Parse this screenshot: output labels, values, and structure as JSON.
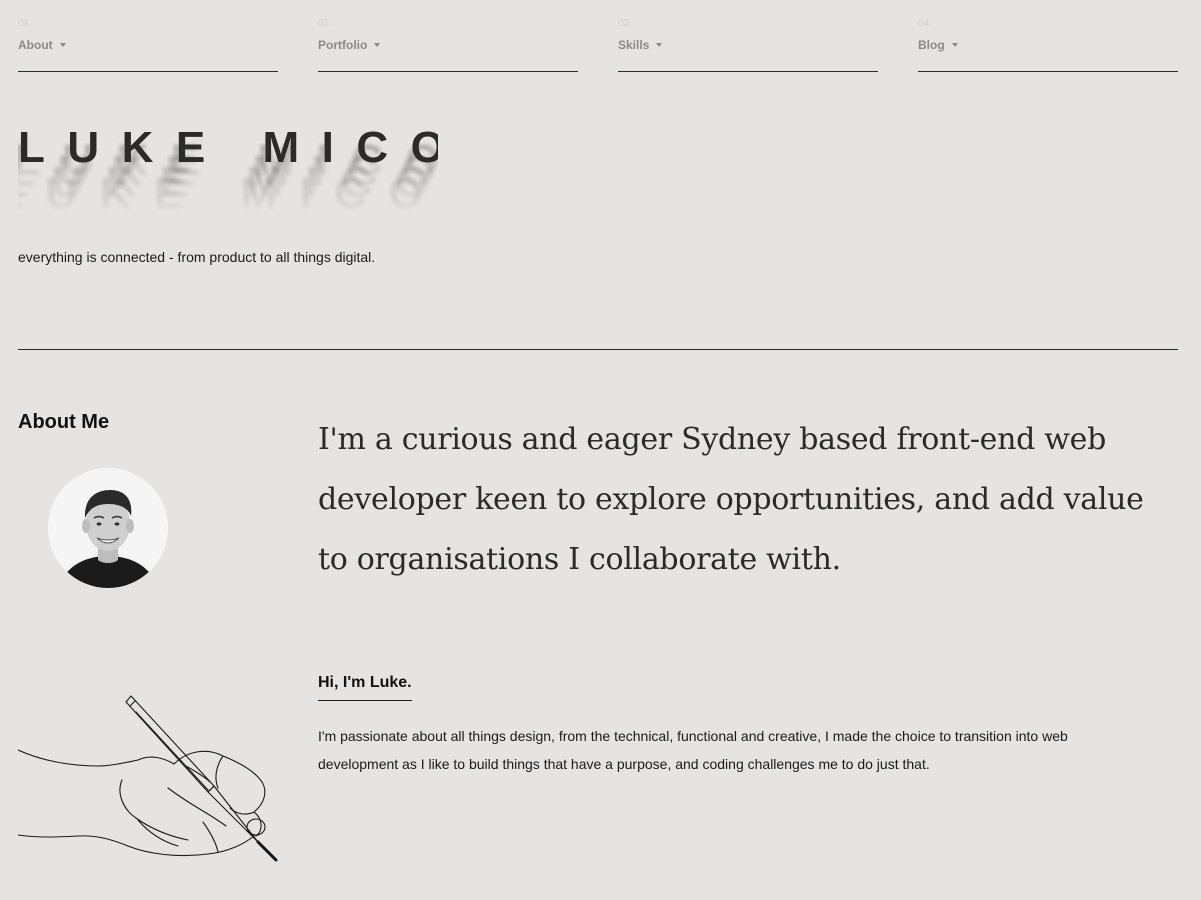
{
  "nav": [
    {
      "num": "01.",
      "label": "About"
    },
    {
      "num": "02.",
      "label": "Portfolio"
    },
    {
      "num": "03.",
      "label": "Skills"
    },
    {
      "num": "04.",
      "label": "Blog"
    }
  ],
  "hero": {
    "name": "LUKE MICO",
    "tagline": "everything is connected - from product to all things digital."
  },
  "about": {
    "heading": "About Me",
    "intro": "I'm a curious and eager Sydney based front-end web developer keen to explore opportunities, and add value to organisations I collaborate with.",
    "greeting": "Hi, I'm Luke.",
    "bio": "I'm passionate about all things design, from the technical, functional and creative, I made the choice to transition into web development as I like to build things that have a purpose, and coding challenges me to do just that."
  },
  "icons": {
    "caret": "caret-down-icon",
    "illustration": "hand-drawing-pencil-icon"
  },
  "colors": {
    "background": "#e5e4e2",
    "text": "#1a1a1a",
    "nav_label": "#8a8a8a"
  }
}
